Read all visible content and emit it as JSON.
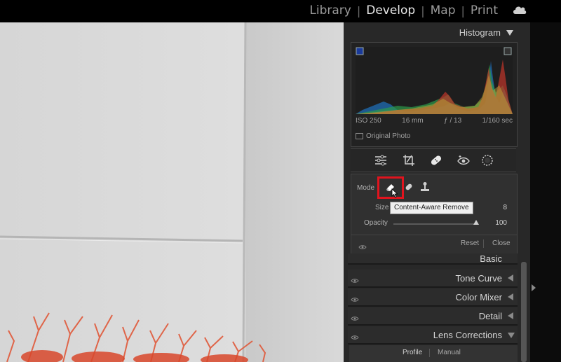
{
  "modules": {
    "items": [
      "Library",
      "Develop",
      "Map",
      "Print"
    ],
    "active_index": 1,
    "separator": "|",
    "cloud_icon": "cloud-icon"
  },
  "histogram": {
    "title": "Histogram",
    "iso": "ISO 250",
    "focal_length": "16 mm",
    "aperture": "ƒ / 13",
    "shutter": "1/160 sec",
    "original_photo_label": "Original Photo"
  },
  "tools": [
    "edit-sliders-icon",
    "crop-icon",
    "healing-icon",
    "red-eye-icon",
    "masking-icon"
  ],
  "healing": {
    "mode_label": "Mode",
    "mode_icons": [
      "content-aware-remove-icon",
      "heal-icon",
      "clone-icon"
    ],
    "tooltip": "Content-Aware Remove",
    "size_label": "Size",
    "size_value": "8",
    "opacity_label": "Opacity",
    "opacity_value": "100",
    "opacity_level": 1.0,
    "reset_label": "Reset",
    "close_label": "Close"
  },
  "panels": {
    "basic": "Basic",
    "tone_curve": "Tone Curve",
    "color_mixer": "Color Mixer",
    "detail": "Detail",
    "lens_corrections": "Lens Corrections",
    "tabs": [
      "Profile",
      "Manual"
    ]
  }
}
